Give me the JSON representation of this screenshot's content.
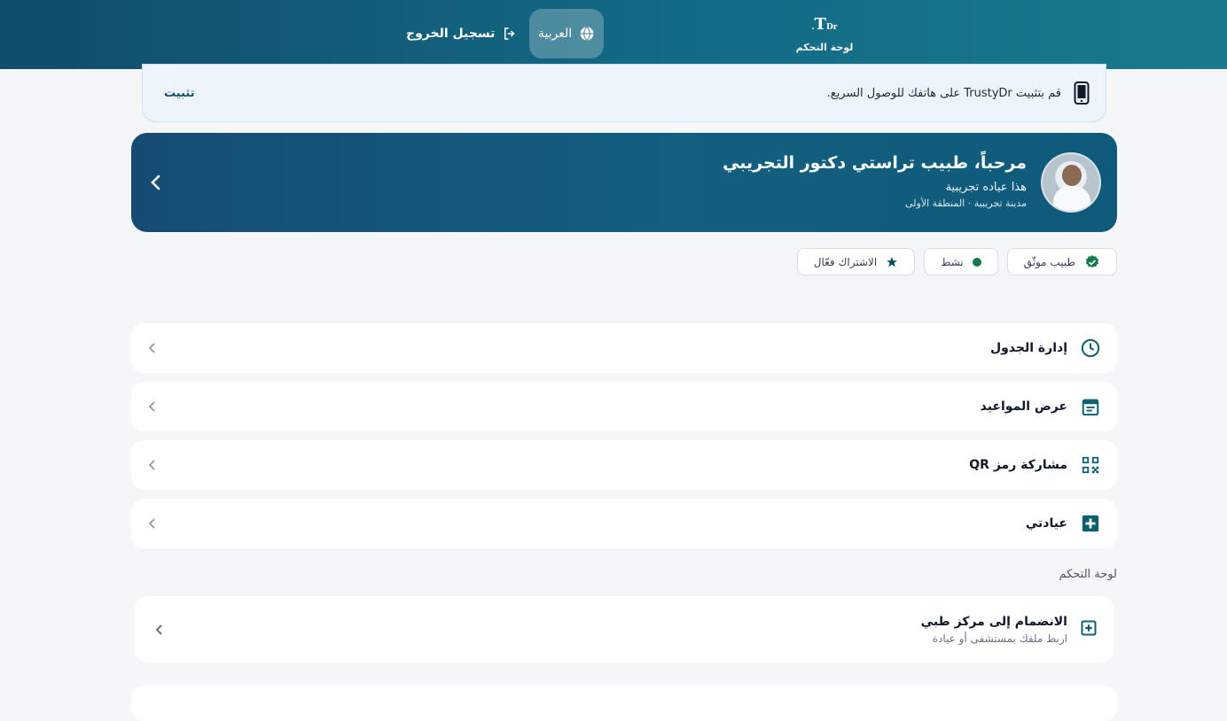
{
  "header": {
    "brand_logo": "T",
    "brand_logo_small": "Dr.",
    "brand_label": "لوحة التحكم",
    "language_label": "العربية",
    "logout_label": "تسجيل الخروج"
  },
  "install_banner": {
    "message": "قم بتثبيت TrustyDr على هاتفك للوصول السريع.",
    "action_label": "تثبيت"
  },
  "profile": {
    "greeting": "مرحباً، طبيب تراستي دكتور التجريبي",
    "clinic": "هذا عياده تجريبية",
    "location": "مدينة تجريبية · المنطقة الأولى"
  },
  "badges": [
    {
      "label": "طبيب موثّق",
      "icon": "verified-icon"
    },
    {
      "label": "نشط",
      "icon": "status-dot-icon"
    },
    {
      "label": "الاشتراك فعّال",
      "icon": "star-icon"
    }
  ],
  "menu": [
    {
      "label": "إدارة الجدول",
      "icon": "clock-icon"
    },
    {
      "label": "عرض المواعيد",
      "icon": "calendar-icon"
    },
    {
      "label": "مشاركة رمز QR",
      "icon": "qr-code-icon"
    },
    {
      "label": "عيادتي",
      "icon": "medical-plus-icon"
    }
  ],
  "section_title": "لوحة التحكم",
  "join_card": {
    "title": "الانضمام إلى مركز طبي",
    "subtitle": "اربط ملفك بمستشفى أو عيادة",
    "icon": "add-box-icon"
  },
  "colors": {
    "primary": "#0f4d6b",
    "accent_green": "#137a4b",
    "icon_teal": "#0f5f6f"
  }
}
